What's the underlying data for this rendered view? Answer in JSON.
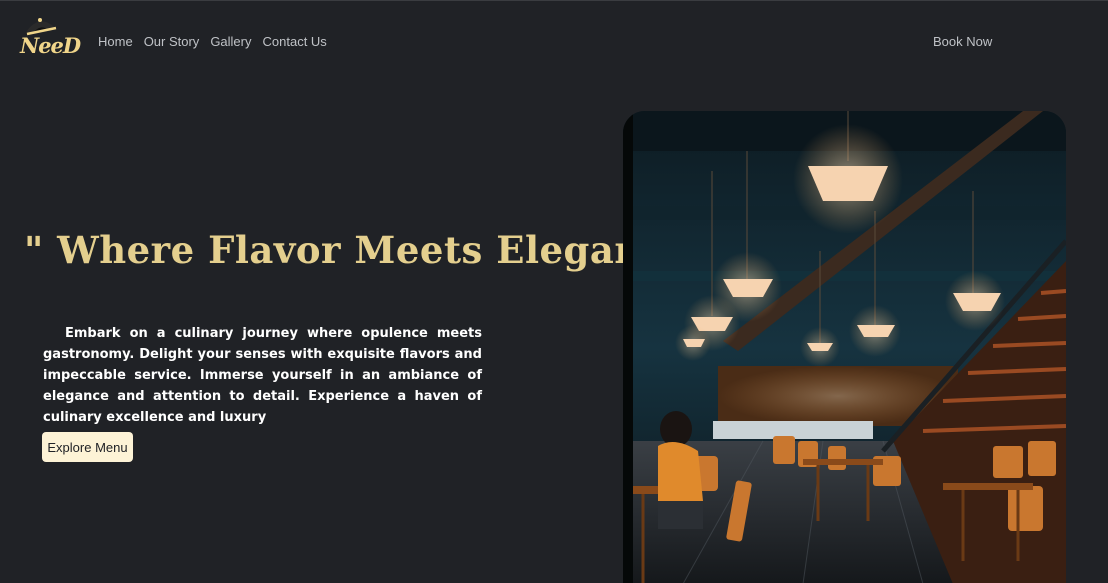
{
  "brand": {
    "logo_text": "NeeD",
    "accent": "#e4cf8e"
  },
  "nav": {
    "items": [
      "Home",
      "Our Story",
      "Gallery",
      "Contact Us"
    ],
    "book_label": "Book Now"
  },
  "hero": {
    "headline": "\" Where Flavor Meets Elegance \"",
    "paragraph": "Embark on a culinary journey where opulence meets gastronomy. Delight your senses with exquisite flavors and impeccable service. Immerse yourself in an ambiance of elegance and attention to detail. Experience a haven of culinary excellence and luxury",
    "button_label": "Explore Menu"
  },
  "colors": {
    "background": "#202226",
    "button_bg": "#fdf3d6",
    "nav_text": "#bfc2c6"
  }
}
